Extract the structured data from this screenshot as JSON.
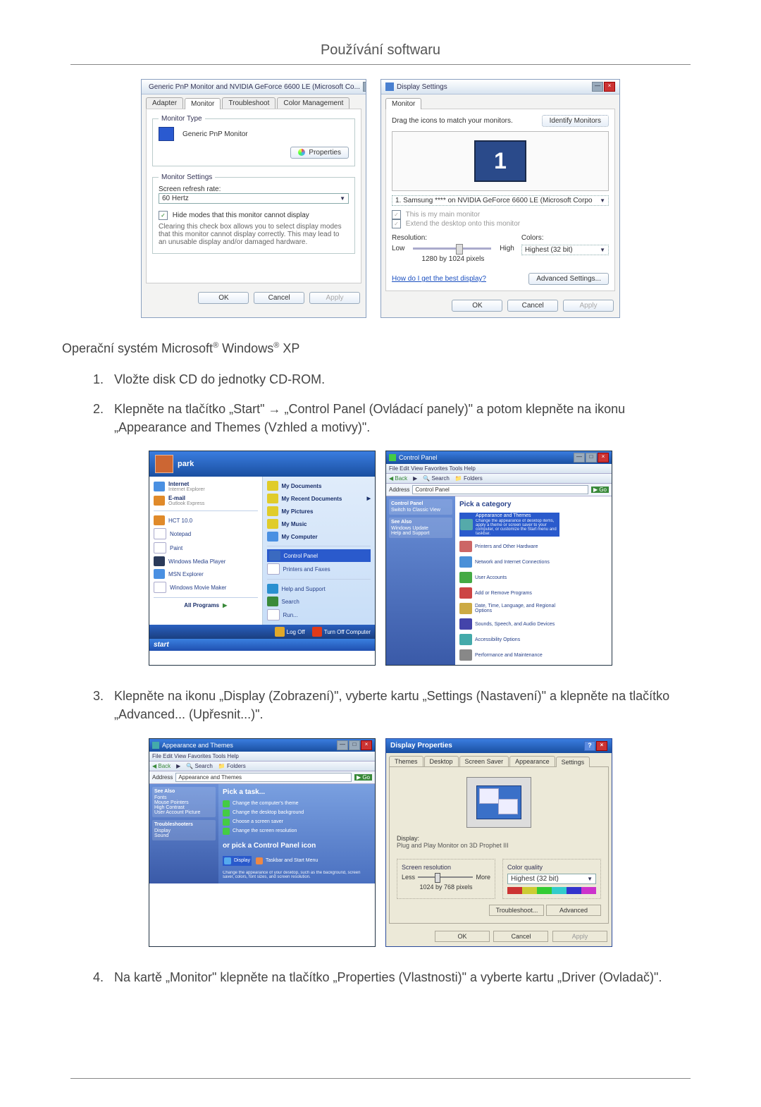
{
  "page": {
    "title": "Používání softwaru"
  },
  "monitor_properties_dialog": {
    "window_title": "Generic PnP Monitor and NVIDIA GeForce 6600 LE (Microsoft Co...",
    "tabs": [
      "Adapter",
      "Monitor",
      "Troubleshoot",
      "Color Management"
    ],
    "active_tab": 1,
    "monitor_type_group": "Monitor Type",
    "monitor_name": "Generic PnP Monitor",
    "properties_btn": "Properties",
    "monitor_settings_group": "Monitor Settings",
    "refresh_rate_label": "Screen refresh rate:",
    "refresh_rate_value": "60 Hertz",
    "hide_modes_checked": true,
    "hide_modes_label": "Hide modes that this monitor cannot display",
    "hide_modes_desc": "Clearing this check box allows you to select display modes that this monitor cannot display correctly. This may lead to an unusable display and/or damaged hardware.",
    "ok": "OK",
    "cancel": "Cancel",
    "apply": "Apply"
  },
  "display_settings_dialog": {
    "window_title": "Display Settings",
    "tab": "Monitor",
    "instruction": "Drag the icons to match your monitors.",
    "identify_btn": "Identify Monitors",
    "monitor_number": "1",
    "monitor_select": "1. Samsung **** on NVIDIA GeForce 6600 LE (Microsoft Corpo",
    "main_monitor_label": "This is my main monitor",
    "extend_label": "Extend the desktop onto this monitor",
    "resolution_label": "Resolution:",
    "res_low": "Low",
    "res_high": "High",
    "resolution_value": "1280 by 1024 pixels",
    "colors_label": "Colors:",
    "colors_value": "Highest (32 bit)",
    "best_display_link": "How do I get the best display?",
    "advanced_btn": "Advanced Settings...",
    "ok": "OK",
    "cancel": "Cancel",
    "apply": "Apply"
  },
  "text": {
    "os_line_prefix": "Operační systém Microsoft",
    "os_line_mid": " Windows",
    "os_line_suffix": " XP",
    "step1": "Vložte disk CD do jednotky CD-ROM.",
    "step2": "Klepněte na tlačítko „Start\" → „Control Panel (Ovládací panely)\" a potom klepněte na ikonu „Appearance and Themes (Vzhled a motivy)\".",
    "step3": "Klepněte na ikonu „Display (Zobrazení)\", vyberte kartu „Settings (Nastavení)\" a klepněte na tlačítko „Advanced... (Upřesnit...)\".",
    "step4": "Na kartě „Monitor\" klepněte na tlačítko „Properties (Vlastnosti)\" a vyberte kartu „Driver (Ovladač)\"."
  },
  "start_menu": {
    "user": "park",
    "left_items": [
      {
        "label": "Internet",
        "sub": "Internet Explorer"
      },
      {
        "label": "E-mail",
        "sub": "Outlook Express"
      },
      {
        "label": "HCT 10.0"
      },
      {
        "label": "Notepad"
      },
      {
        "label": "Paint"
      },
      {
        "label": "Windows Media Player"
      },
      {
        "label": "MSN Explorer"
      },
      {
        "label": "Windows Movie Maker"
      }
    ],
    "all_programs": "All Programs",
    "right_items": [
      {
        "label": "My Documents",
        "bold": true
      },
      {
        "label": "My Recent Documents",
        "bold": true,
        "arrow": true
      },
      {
        "label": "My Pictures",
        "bold": true
      },
      {
        "label": "My Music",
        "bold": true
      },
      {
        "label": "My Computer",
        "bold": true
      },
      {
        "label": "Control Panel",
        "selected": true
      },
      {
        "label": "Printers and Faxes"
      },
      {
        "label": "Help and Support"
      },
      {
        "label": "Search"
      },
      {
        "label": "Run..."
      }
    ],
    "logoff": "Log Off",
    "shutdown": "Turn Off Computer",
    "start": "start"
  },
  "control_panel": {
    "title": "Control Panel",
    "menu": "File  Edit  View  Favorites  Tools  Help",
    "address_label": "Address",
    "address_value": "Control Panel",
    "side_header": "Control Panel",
    "side_items": [
      "Switch to Classic View"
    ],
    "see_also": "See Also",
    "see_also_items": [
      "Windows Update",
      "Help and Support"
    ],
    "heading": "Pick a category",
    "categories": [
      "Appearance and Themes",
      "Printers and Other Hardware",
      "Network and Internet Connections",
      "User Accounts",
      "Add or Remove Programs",
      "Date, Time, Language, and Regional Options",
      "Sounds, Speech, and Audio Devices",
      "Accessibility Options",
      "Performance and Maintenance"
    ],
    "selected_hint": "Change the appearance of desktop items, apply a theme or screen saver to your computer, or customize the Start menu and taskbar."
  },
  "appearance_themes": {
    "title": "Appearance and Themes",
    "menu": "File  Edit  View  Favorites  Tools  Help",
    "address_value": "Appearance and Themes",
    "side_header": "See Also",
    "side_items": [
      "Fonts",
      "Mouse Pointers",
      "High Contrast",
      "User Account Picture"
    ],
    "troubleshooters": "Troubleshooters",
    "ts_items": [
      "Display",
      "Sound"
    ],
    "heading_task": "Pick a task...",
    "tasks": [
      "Change the computer's theme",
      "Change the desktop background",
      "Choose a screen saver",
      "Change the screen resolution"
    ],
    "heading_icon": "or pick a Control Panel icon",
    "icons": [
      "Display",
      "Taskbar and Start Menu"
    ],
    "icon_hint": "Change the appearance of your desktop, such as the background, screen saver, colors, font sizes, and screen resolution."
  },
  "display_properties": {
    "title": "Display Properties",
    "tabs": [
      "Themes",
      "Desktop",
      "Screen Saver",
      "Appearance",
      "Settings"
    ],
    "active_tab": 4,
    "display_label": "Display:",
    "display_value": "Plug and Play Monitor on 3D Prophet III",
    "screen_res_label": "Screen resolution",
    "res_less": "Less",
    "res_more": "More",
    "res_value": "1024 by 768 pixels",
    "color_quality_label": "Color quality",
    "color_quality_value": "Highest (32 bit)",
    "troubleshoot": "Troubleshoot...",
    "advanced": "Advanced",
    "ok": "OK",
    "cancel": "Cancel",
    "apply": "Apply"
  }
}
